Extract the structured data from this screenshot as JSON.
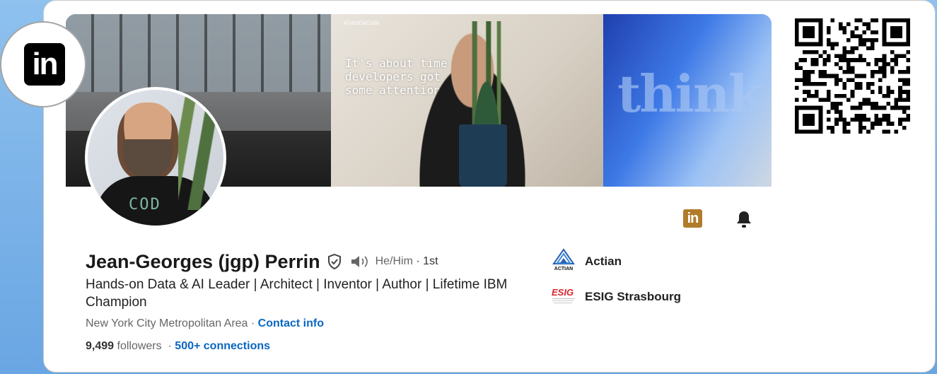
{
  "profile": {
    "name": "Jean-Georges (jgp) Perrin",
    "pronouns": "He/Him",
    "degree": "· 1st",
    "headline": "Hands-on Data & AI Leader | Architect | Inventor | Author | Lifetime IBM Champion",
    "location": "New York City Metropolitan Area",
    "location_sep": " · ",
    "contact_info": "Contact info",
    "followers_count": "9,499",
    "followers_label": " followers",
    "connections_sep": "  · ",
    "connections": "500+ connections"
  },
  "banner": {
    "poster_tag": "#GetsDeCode",
    "poster_text": "It's about time developers got some attention.",
    "building_text": "think"
  },
  "logo": {
    "text": "in"
  },
  "avatar": {
    "shirt_text": "COD"
  },
  "actions": {
    "linkedin_icon_text": "in"
  },
  "experience": [
    {
      "name": "Actian",
      "logo_text": "ACTIAN"
    },
    {
      "name": "ESIG Strasbourg",
      "logo_text": "ESIG"
    }
  ],
  "colors": {
    "link": "#0a66c2",
    "linkedin_gold": "#b07c2a",
    "background": "#7eb4ea"
  },
  "icons": {
    "verified": "verified-shield-icon",
    "speaker": "speaker-icon",
    "bell": "bell-icon",
    "qr": "qr-code-icon"
  }
}
